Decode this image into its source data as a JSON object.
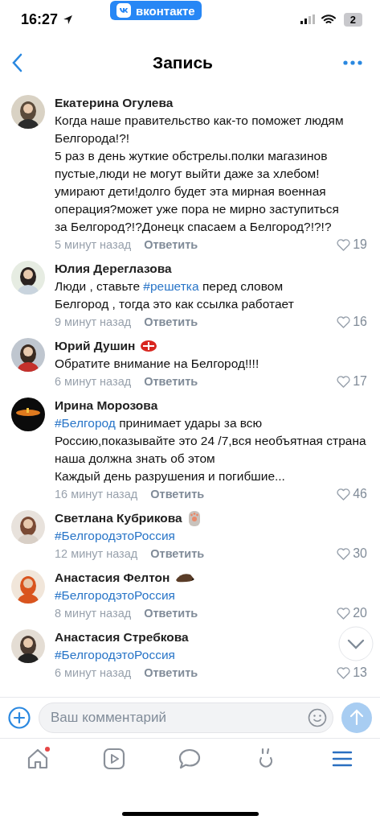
{
  "status_bar": {
    "time": "16:27",
    "app_badge": "вконтакте",
    "battery": "2"
  },
  "header": {
    "title": "Запись"
  },
  "comments": [
    {
      "kind": "plain",
      "author": "Екатерина Огулева",
      "body": [
        {
          "kind": "text",
          "text": "Когда наше правительство как-то поможет людям\nБелгорода!?!\n5 раз в день жуткие обстрелы.полки магазинов пустые,люди не могут выйти даже за хлебом! умирают дети!долго будет эта мирная военная операция?может уже пора не мирно заступиться\nза Белгород?!?Донецк спасаем а Белгород?!?!?"
        }
      ],
      "time": "5 минут назад",
      "reply": "Ответить",
      "likes": "19"
    },
    {
      "kind": "plain",
      "author": "Юлия Дереглазова",
      "body": [
        {
          "kind": "text",
          "text": "Люди , ставьте "
        },
        {
          "kind": "hashtag",
          "text": "#решетка"
        },
        {
          "kind": "text",
          "text": " перед словом\nБелгород , тогда это как ссылка работает"
        }
      ],
      "time": "9 минут назад",
      "reply": "Ответить",
      "likes": "16"
    },
    {
      "kind": "emblem",
      "author": "Юрий Душин",
      "body": [
        {
          "kind": "text",
          "text": "Обратите внимание на Белгород!!!!"
        }
      ],
      "time": "6 минут назад",
      "reply": "Ответить",
      "likes": "17"
    },
    {
      "kind": "plain",
      "author": "Ирина Морозова",
      "body": [
        {
          "kind": "hashtag",
          "text": "#Белгород"
        },
        {
          "kind": "text",
          "text": " принимает удары за всю Россию,показывайте это 24 /7,вся необъятная страна наша должна знать об этом\nКаждый день  разрушения и погибшие..."
        }
      ],
      "time": "16 минут назад",
      "reply": "Ответить",
      "likes": "46"
    },
    {
      "kind": "paw",
      "author": "Светлана Кубрикова",
      "body": [
        {
          "kind": "hashtag",
          "text": "#БелгородэтоРоссия"
        }
      ],
      "time": "12 минут назад",
      "reply": "Ответить",
      "likes": "30"
    },
    {
      "kind": "hedgehog",
      "author": "Анастасия Фелтон",
      "body": [
        {
          "kind": "hashtag",
          "text": "#БелгородэтоРоссия"
        }
      ],
      "time": "8 минут назад",
      "reply": "Ответить",
      "likes": "20"
    },
    {
      "kind": "plain",
      "author": "Анастасия Стребкова",
      "body": [
        {
          "kind": "hashtag",
          "text": "#БелгородэтоРоссия"
        }
      ],
      "time": "6 минут назад",
      "reply": "Ответить",
      "likes": "13"
    }
  ],
  "composer": {
    "placeholder": "Ваш комментарий"
  },
  "tab_bar": [
    {
      "kind": "home",
      "selected": false,
      "notification": true
    },
    {
      "kind": "video",
      "selected": false,
      "notification": false
    },
    {
      "kind": "messages",
      "selected": false,
      "notification": false
    },
    {
      "kind": "clips",
      "selected": false,
      "notification": false
    },
    {
      "kind": "menu",
      "selected": true,
      "notification": false
    }
  ]
}
